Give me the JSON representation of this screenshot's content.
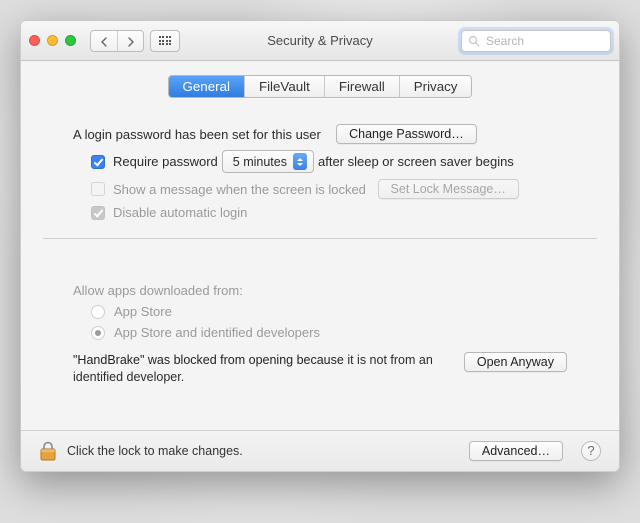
{
  "window": {
    "title": "Security & Privacy"
  },
  "toolbar": {
    "search_placeholder": "Search"
  },
  "tabs": [
    "General",
    "FileVault",
    "Firewall",
    "Privacy"
  ],
  "active_tab_index": 0,
  "login": {
    "msg": "A login password has been set for this user",
    "change_btn": "Change Password…",
    "require_label": "Require password",
    "require_checked": true,
    "delay_value": "5 minutes",
    "after_label": "after sleep or screen saver begins",
    "show_msg_label": "Show a message when the screen is locked",
    "show_msg_checked": false,
    "set_lock_btn": "Set Lock Message…",
    "disable_auto_label": "Disable automatic login",
    "disable_auto_checked": true
  },
  "gatekeeper": {
    "heading": "Allow apps downloaded from:",
    "opt_appstore": "App Store",
    "opt_identified": "App Store and identified developers",
    "selected": "identified",
    "blocked_msg_prefix": "\"HandBrake\" was blocked from opening because",
    "blocked_msg_rest": " it is not from an identified developer.",
    "open_anyway_btn": "Open Anyway"
  },
  "footer": {
    "lock_msg": "Click the lock to make changes.",
    "advanced_btn": "Advanced…",
    "help": "?"
  }
}
